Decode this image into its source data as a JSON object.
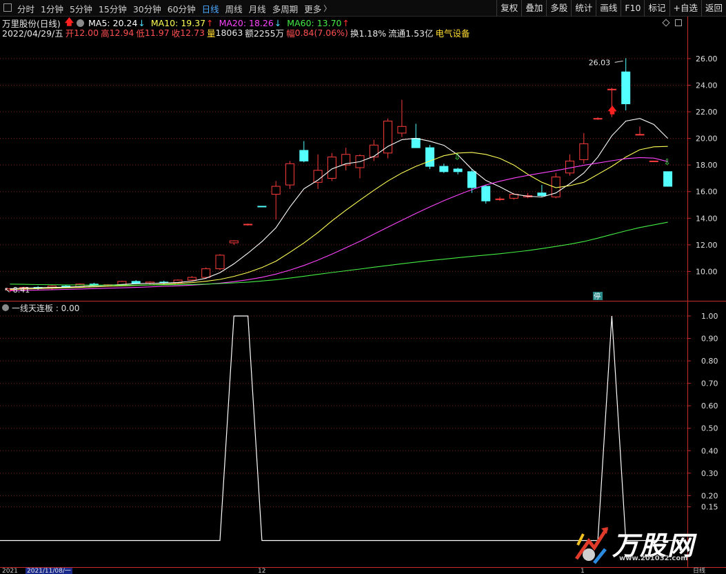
{
  "toolbar": {
    "periods": [
      "分时",
      "1分钟",
      "5分钟",
      "15分钟",
      "30分钟",
      "60分钟",
      "日线",
      "周线",
      "月线",
      "多周期",
      "更多"
    ],
    "active_period": "日线",
    "tools": [
      "复权",
      "叠加",
      "多股",
      "统计",
      "画线",
      "F10",
      "标记",
      "+自选",
      "返回"
    ]
  },
  "title": {
    "stock_name": "万里股份(日线)",
    "ma5": "MA5: 20.24",
    "ma10": "MA10: 19.37",
    "ma20": "MA20: 18.26",
    "ma60": "MA60: 13.70"
  },
  "quote": {
    "date": "2022/04/29/五",
    "open_label": "开",
    "open": "12.00",
    "high_label": "高",
    "high": "12.94",
    "low_label": "低",
    "low": "11.97",
    "close_label": "收",
    "close": "12.73",
    "vol_label": "量",
    "vol": "18063",
    "amount_label": "额",
    "amount": "2255万",
    "chg_label": "幅",
    "chg": "0.84(7.06%)",
    "turnover": "换1.18%",
    "float": "流通1.53亿",
    "industry": "电气设备"
  },
  "sub_indicator": {
    "label": "一线天连板 : 0.00"
  },
  "date_axis": {
    "start": "2021",
    "cursor_date": "2021/11/08/一",
    "month_12": "12",
    "month_1": "1",
    "period": "日线"
  },
  "watermark": {
    "brand": "万股网",
    "url": "www.201032.com"
  },
  "colors": {
    "up": "#ff3c3c",
    "down": "#54ffff",
    "ma5": "#ffffff",
    "ma10": "#ffff55",
    "ma20": "#ff44ff",
    "ma60": "#44ee44",
    "grid": "#8a1818"
  },
  "chart_data": [
    {
      "type": "candlestick",
      "title": "万里股份(日线)",
      "y_ticks": [
        10.0,
        12.0,
        14.0,
        16.0,
        18.0,
        20.0,
        22.0,
        24.0,
        26.0
      ],
      "ylim": [
        8.0,
        27.5
      ],
      "max_label": "26.03",
      "min_label": "8.41",
      "candles": [
        {
          "o": 8.6,
          "h": 8.75,
          "l": 8.45,
          "c": 8.7
        },
        {
          "o": 8.7,
          "h": 8.85,
          "l": 8.55,
          "c": 8.8
        },
        {
          "o": 8.8,
          "h": 8.9,
          "l": 8.6,
          "c": 8.75
        },
        {
          "o": 8.75,
          "h": 8.95,
          "l": 8.65,
          "c": 8.9
        },
        {
          "o": 8.9,
          "h": 9.0,
          "l": 8.75,
          "c": 8.85
        },
        {
          "o": 8.85,
          "h": 9.1,
          "l": 8.8,
          "c": 9.05
        },
        {
          "o": 9.05,
          "h": 9.15,
          "l": 8.9,
          "c": 8.95
        },
        {
          "o": 8.95,
          "h": 9.05,
          "l": 8.85,
          "c": 9.0
        },
        {
          "o": 9.0,
          "h": 9.3,
          "l": 8.9,
          "c": 9.25
        },
        {
          "o": 9.25,
          "h": 9.35,
          "l": 9.05,
          "c": 9.1
        },
        {
          "o": 9.1,
          "h": 9.25,
          "l": 9.0,
          "c": 9.2
        },
        {
          "o": 9.2,
          "h": 9.3,
          "l": 9.05,
          "c": 9.15
        },
        {
          "o": 9.15,
          "h": 9.4,
          "l": 9.05,
          "c": 9.35
        },
        {
          "o": 9.35,
          "h": 9.65,
          "l": 9.25,
          "c": 9.55
        },
        {
          "o": 9.55,
          "h": 10.3,
          "l": 9.5,
          "c": 10.2
        },
        {
          "o": 10.2,
          "h": 11.3,
          "l": 10.1,
          "c": 11.22
        },
        {
          "o": 12.15,
          "h": 12.35,
          "l": 12.0,
          "c": 12.3
        },
        {
          "o": 13.5,
          "h": 13.6,
          "l": 13.45,
          "c": 13.55
        },
        {
          "o": 14.9,
          "h": 14.9,
          "l": 14.85,
          "c": 14.88
        },
        {
          "o": 15.8,
          "h": 16.8,
          "l": 13.9,
          "c": 16.4
        },
        {
          "o": 16.5,
          "h": 18.3,
          "l": 16.2,
          "c": 18.1
        },
        {
          "o": 19.1,
          "h": 19.8,
          "l": 18.2,
          "c": 18.3
        },
        {
          "o": 16.7,
          "h": 18.8,
          "l": 16.2,
          "c": 17.6
        },
        {
          "o": 17.0,
          "h": 18.9,
          "l": 16.8,
          "c": 18.6
        },
        {
          "o": 18.0,
          "h": 19.3,
          "l": 17.6,
          "c": 18.8
        },
        {
          "o": 17.8,
          "h": 18.8,
          "l": 17.0,
          "c": 18.7
        },
        {
          "o": 18.6,
          "h": 19.9,
          "l": 18.3,
          "c": 19.5
        },
        {
          "o": 18.9,
          "h": 21.5,
          "l": 18.5,
          "c": 21.3
        },
        {
          "o": 20.4,
          "h": 22.9,
          "l": 20.1,
          "c": 20.9
        },
        {
          "o": 20.0,
          "h": 21.1,
          "l": 19.6,
          "c": 19.3
        },
        {
          "o": 19.3,
          "h": 19.5,
          "l": 17.7,
          "c": 17.9
        },
        {
          "o": 17.9,
          "h": 18.1,
          "l": 17.4,
          "c": 17.5
        },
        {
          "o": 17.7,
          "h": 17.8,
          "l": 17.3,
          "c": 17.5
        },
        {
          "o": 17.5,
          "h": 17.7,
          "l": 15.9,
          "c": 16.3
        },
        {
          "o": 16.4,
          "h": 16.5,
          "l": 15.1,
          "c": 15.3
        },
        {
          "o": 15.4,
          "h": 15.6,
          "l": 15.3,
          "c": 15.45
        },
        {
          "o": 15.5,
          "h": 15.9,
          "l": 15.4,
          "c": 15.8
        },
        {
          "o": 15.6,
          "h": 15.9,
          "l": 15.5,
          "c": 15.7
        },
        {
          "o": 15.9,
          "h": 16.5,
          "l": 15.6,
          "c": 15.7
        },
        {
          "o": 15.6,
          "h": 17.4,
          "l": 15.5,
          "c": 17.1
        },
        {
          "o": 17.4,
          "h": 18.8,
          "l": 17.2,
          "c": 18.3
        },
        {
          "o": 18.4,
          "h": 20.4,
          "l": 18.1,
          "c": 19.6
        },
        {
          "o": 21.5,
          "h": 21.6,
          "l": 21.4,
          "c": 21.5
        },
        {
          "o": 23.7,
          "h": 23.8,
          "l": 21.6,
          "c": 23.7
        },
        {
          "o": 25.0,
          "h": 26.03,
          "l": 22.1,
          "c": 22.6
        },
        {
          "o": 20.3,
          "h": 20.9,
          "l": 20.3,
          "c": 20.3
        },
        {
          "o": 18.3,
          "h": 18.3,
          "l": 18.3,
          "c": 18.3
        },
        {
          "o": 17.5,
          "h": 17.5,
          "l": 16.4,
          "c": 16.4
        }
      ],
      "series": [
        {
          "name": "MA5",
          "values": [
            8.7,
            8.75,
            8.78,
            8.8,
            8.82,
            8.86,
            8.92,
            8.96,
            9.02,
            9.08,
            9.1,
            9.13,
            9.17,
            9.27,
            9.49,
            9.91,
            10.57,
            11.37,
            12.24,
            13.28,
            14.84,
            16.21,
            16.87,
            17.71,
            18.1,
            18.25,
            18.65,
            19.4,
            19.91,
            20.01,
            19.79,
            19.48,
            18.76,
            17.68,
            16.84,
            16.36,
            15.81,
            15.65,
            15.6,
            15.9,
            16.6,
            17.4,
            18.6,
            20.2,
            21.3,
            21.5,
            21.05,
            20.0
          ]
        },
        {
          "name": "MA10",
          "values": [
            8.65,
            8.68,
            8.71,
            8.74,
            8.77,
            8.8,
            8.84,
            8.88,
            8.92,
            8.95,
            8.99,
            9.04,
            9.09,
            9.16,
            9.26,
            9.4,
            9.63,
            9.92,
            10.29,
            10.77,
            11.44,
            12.14,
            12.92,
            13.8,
            14.6,
            15.36,
            16.1,
            16.8,
            17.4,
            17.9,
            18.3,
            18.7,
            18.9,
            18.95,
            18.8,
            18.5,
            18.0,
            17.3,
            16.7,
            16.3,
            16.45,
            16.7,
            17.3,
            17.9,
            18.6,
            19.15,
            19.37,
            19.4
          ]
        },
        {
          "name": "MA20",
          "values": [
            8.55,
            8.58,
            8.6,
            8.63,
            8.65,
            8.68,
            8.71,
            8.74,
            8.77,
            8.8,
            8.84,
            8.88,
            8.92,
            8.97,
            9.03,
            9.12,
            9.23,
            9.38,
            9.56,
            9.8,
            10.1,
            10.45,
            10.85,
            11.3,
            11.78,
            12.27,
            12.8,
            13.33,
            13.85,
            14.36,
            14.85,
            15.32,
            15.75,
            16.15,
            16.5,
            16.78,
            17.02,
            17.22,
            17.4,
            17.58,
            17.78,
            17.98,
            18.15,
            18.32,
            18.48,
            18.56,
            18.52,
            18.26
          ]
        },
        {
          "name": "MA60",
          "values": [
            9.05,
            9.03,
            9.01,
            9.0,
            8.99,
            8.98,
            8.97,
            8.97,
            8.97,
            8.97,
            8.98,
            8.99,
            9.0,
            9.02,
            9.05,
            9.09,
            9.14,
            9.2,
            9.28,
            9.38,
            9.5,
            9.64,
            9.78,
            9.92,
            10.05,
            10.18,
            10.32,
            10.45,
            10.58,
            10.7,
            10.82,
            10.92,
            11.03,
            11.13,
            11.23,
            11.33,
            11.45,
            11.57,
            11.72,
            11.88,
            12.05,
            12.25,
            12.5,
            12.78,
            13.05,
            13.3,
            13.5,
            13.7
          ]
        }
      ]
    },
    {
      "type": "line",
      "title": "一线天连板",
      "y_ticks": [
        0.15,
        0.2,
        0.3,
        0.4,
        0.5,
        0.6,
        0.7,
        0.8,
        0.9,
        1.0
      ],
      "ylim": [
        -0.1,
        1.0
      ],
      "series": [
        {
          "name": "一线天连板",
          "values": [
            0,
            0,
            0,
            0,
            0,
            0,
            0,
            0,
            0,
            0,
            0,
            0,
            0,
            0,
            0,
            0,
            1,
            1,
            0,
            0,
            0,
            0,
            0,
            0,
            0,
            0,
            0,
            0,
            0,
            0,
            0,
            0,
            0,
            0,
            0,
            0,
            0,
            0,
            0,
            0,
            0,
            0,
            0,
            1,
            0,
            0,
            0,
            0
          ]
        }
      ]
    }
  ]
}
